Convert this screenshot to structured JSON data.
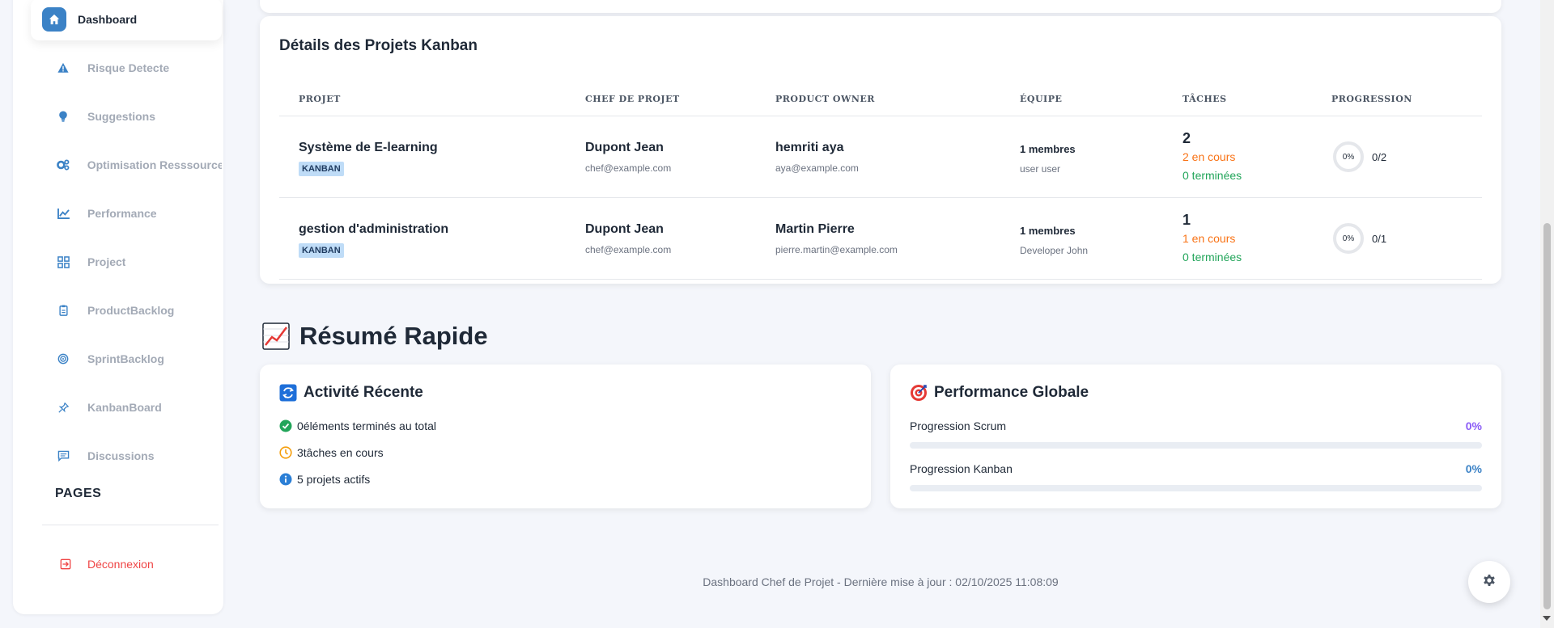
{
  "sidebar": {
    "items": [
      {
        "label": "Dashboard",
        "icon": "home-icon"
      },
      {
        "label": "Risque Detecte",
        "icon": "warning-icon"
      },
      {
        "label": "Suggestions",
        "icon": "lightbulb-icon"
      },
      {
        "label": "Optimisation Resssource",
        "icon": "gears-icon"
      },
      {
        "label": "Performance",
        "icon": "chart-line-icon"
      },
      {
        "label": "Project",
        "icon": "grid-icon"
      },
      {
        "label": "ProductBacklog",
        "icon": "clipboard-icon"
      },
      {
        "label": "SprintBacklog",
        "icon": "target-icon"
      },
      {
        "label": "KanbanBoard",
        "icon": "pin-icon"
      },
      {
        "label": "Discussions",
        "icon": "chat-icon"
      }
    ],
    "pages_title": "PAGES",
    "logout_label": "Déconnexion"
  },
  "kanban": {
    "title": "Détails des Projets Kanban",
    "headers": {
      "projet": "PROJET",
      "chef": "CHEF DE PROJET",
      "po": "PRODUCT OWNER",
      "equipe": "ÉQUIPE",
      "taches": "TÂCHES",
      "progression": "PROGRESSION"
    },
    "rows": [
      {
        "project": "Système de E-learning",
        "badge": "KANBAN",
        "chef_name": "Dupont Jean",
        "chef_email": "chef@example.com",
        "po_name": "hemriti aya",
        "po_email": "aya@example.com",
        "team_count": "1 membres",
        "team_member": "user user",
        "tasks_total": "2",
        "tasks_in_progress": "2 en cours",
        "tasks_done": "0 terminées",
        "progress_pct": "0%",
        "progress_frac": "0/2"
      },
      {
        "project": "gestion d'administration",
        "badge": "KANBAN",
        "chef_name": "Dupont Jean",
        "chef_email": "chef@example.com",
        "po_name": "Martin Pierre",
        "po_email": "pierre.martin@example.com",
        "team_count": "1 membres",
        "team_member": "Developer John",
        "tasks_total": "1",
        "tasks_in_progress": "1 en cours",
        "tasks_done": "0 terminées",
        "progress_pct": "0%",
        "progress_frac": "0/1"
      }
    ]
  },
  "summary": {
    "title": "Résumé Rapide",
    "activity": {
      "title": "Activité Récente",
      "items": [
        {
          "text": "0éléments terminés au total",
          "icon": "check-circle-icon"
        },
        {
          "text": "3tâches en cours",
          "icon": "clock-icon"
        },
        {
          "text": "5 projets actifs",
          "icon": "info-icon"
        }
      ]
    },
    "performance": {
      "title": "Performance Globale",
      "rows": [
        {
          "label": "Progression Scrum",
          "value": "0%",
          "fraction": 0,
          "color": "#8b5cf6"
        },
        {
          "label": "Progression Kanban",
          "value": "0%",
          "fraction": 0,
          "color": "#3b82c6"
        }
      ]
    }
  },
  "footer": "Dashboard Chef de Projet - Dernière mise à jour : 02/10/2025 11:08:09",
  "colors": {
    "accent": "#3b82c6",
    "in_progress": "#f97316",
    "done": "#22a55a",
    "danger": "#ef4444"
  }
}
